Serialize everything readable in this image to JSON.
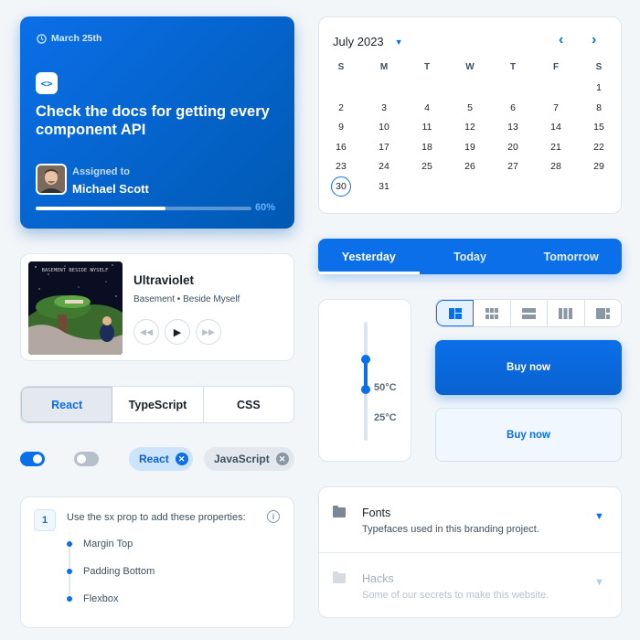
{
  "task": {
    "date": "March 25th",
    "title": "Check the docs for getting every component API",
    "assigned_label": "Assigned to",
    "assignee": "Michael Scott",
    "progress": 60,
    "progress_label": "60%"
  },
  "calendar": {
    "month": "July 2023",
    "weekdays": [
      "S",
      "M",
      "T",
      "W",
      "T",
      "F",
      "S"
    ],
    "first_weekday_index": 6,
    "days_in_month": 31,
    "selected_day": 30
  },
  "music": {
    "title": "Ultraviolet",
    "artist": "Basement • Beside Myself",
    "album_art_text": "BASEMENT BESIDE MYSELF",
    "controls": [
      "rewind-icon",
      "play-icon",
      "fast-forward-icon"
    ]
  },
  "date_tabs": {
    "items": [
      "Yesterday",
      "Today",
      "Tomorrow"
    ],
    "active": 0
  },
  "temperature": {
    "range_labels": [
      "50°C",
      "25°C"
    ],
    "value_high": 50,
    "value_low": 25
  },
  "view_toggle": {
    "items": [
      "quilt-view-icon",
      "module-view-icon",
      "agenda-view-icon",
      "week-view-icon",
      "sidebar-view-icon"
    ],
    "active": 0
  },
  "buy": {
    "primary_label": "Buy now",
    "secondary_label": "Buy now"
  },
  "language_toggle": {
    "items": [
      "React",
      "TypeScript",
      "CSS"
    ],
    "active": 0
  },
  "switches": [
    true,
    false
  ],
  "chips": [
    {
      "label": "React",
      "color": "#0a6fe8"
    },
    {
      "label": "JavaScript",
      "color": "#8a98a6"
    }
  ],
  "steps": {
    "number": "1",
    "text": "Use the sx prop to add these properties:",
    "items": [
      "Margin Top",
      "Padding Bottom",
      "Flexbox"
    ]
  },
  "accordion": [
    {
      "title": "Fonts",
      "subtitle": "Typefaces used in this branding project.",
      "enabled": true
    },
    {
      "title": "Hacks",
      "subtitle": "Some of our secrets to make this website.",
      "enabled": false
    }
  ],
  "colors": {
    "primary": "#0a6fe8",
    "background": "#f3f6f9"
  }
}
